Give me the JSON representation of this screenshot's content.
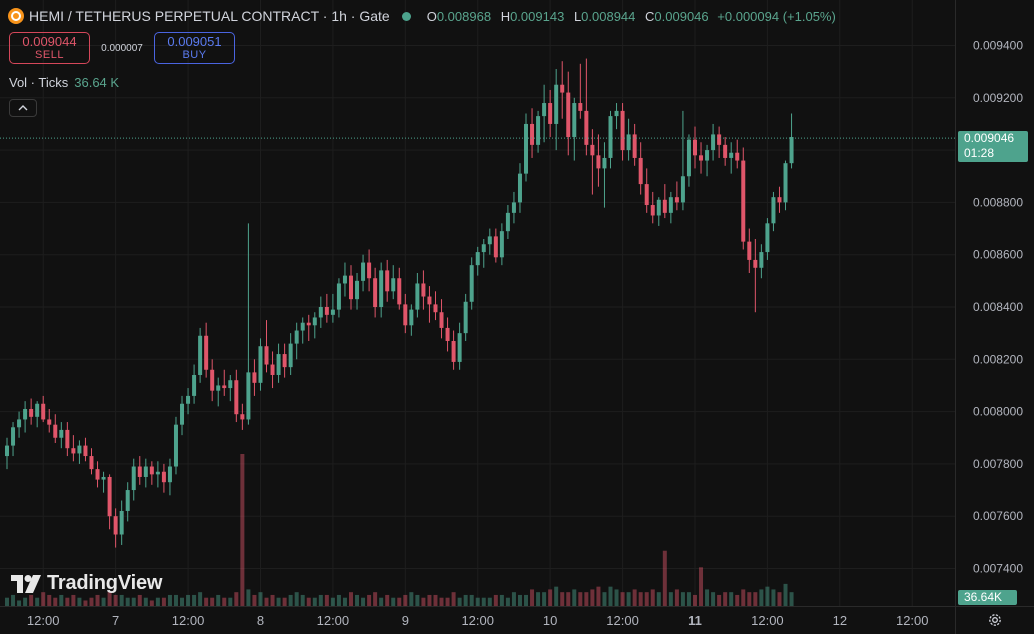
{
  "header": {
    "title": "HEMI / TETHERUS PERPETUAL CONTRACT · 1h · Gate",
    "ohlc": [
      {
        "k": "O",
        "v": "0.008968"
      },
      {
        "k": "H",
        "v": "0.009143"
      },
      {
        "k": "L",
        "v": "0.008944"
      },
      {
        "k": "C",
        "v": "0.009046"
      }
    ],
    "change": "+0.000094 (+1.05%)"
  },
  "trade": {
    "sell_price": "0.009044",
    "sell_label": "SELL",
    "spread": "0.000007",
    "buy_price": "0.009051",
    "buy_label": "BUY"
  },
  "volume_legend": {
    "label": "Vol · Ticks",
    "value": "36.64 K"
  },
  "logo": {
    "text": "TradingView"
  },
  "last_price": {
    "value": "0.009046",
    "countdown": "01:28"
  },
  "volume_tag": "36.64K",
  "colors": {
    "up": "#4ea38d",
    "down": "#e0566a",
    "background": "#111111",
    "grid": "#1e1e1e",
    "text": "#d1d4dc"
  },
  "icons": {
    "symbol": "hemi-logo-icon",
    "status": "market-open-dot-icon",
    "collapse": "chevron-up-icon",
    "settings": "gear-icon"
  },
  "chart_data": {
    "type": "candlestick",
    "y_ticks": [
      "0.009400",
      "0.009200",
      "0.009000",
      "0.008800",
      "0.008600",
      "0.008400",
      "0.008200",
      "0.008000",
      "0.007800",
      "0.007600",
      "0.007400"
    ],
    "ylim": [
      0.0073,
      0.0095
    ],
    "x_ticks": [
      "12:00",
      "7",
      "12:00",
      "8",
      "12:00",
      "9",
      "12:00",
      "10",
      "12:00",
      "11",
      "12:00",
      "12",
      "12:00"
    ],
    "x_tick_candle_index": [
      6,
      18,
      30,
      42,
      54,
      66,
      78,
      90,
      102,
      114,
      126,
      138,
      150
    ],
    "candles": [
      [
        0.00783,
        0.0079,
        0.00778,
        0.00787
      ],
      [
        0.00787,
        0.00796,
        0.00783,
        0.00794
      ],
      [
        0.00794,
        0.008,
        0.0079,
        0.00797
      ],
      [
        0.00797,
        0.00804,
        0.00792,
        0.00801
      ],
      [
        0.00801,
        0.00805,
        0.00795,
        0.00798
      ],
      [
        0.00798,
        0.00804,
        0.00794,
        0.00803
      ],
      [
        0.00803,
        0.00806,
        0.00796,
        0.00797
      ],
      [
        0.00797,
        0.00801,
        0.00792,
        0.00795
      ],
      [
        0.00795,
        0.00799,
        0.00788,
        0.0079
      ],
      [
        0.0079,
        0.00796,
        0.00786,
        0.00793
      ],
      [
        0.00793,
        0.00796,
        0.00783,
        0.00786
      ],
      [
        0.00786,
        0.00791,
        0.00781,
        0.00784
      ],
      [
        0.00784,
        0.00789,
        0.0078,
        0.00787
      ],
      [
        0.00787,
        0.0079,
        0.00781,
        0.00783
      ],
      [
        0.00783,
        0.00786,
        0.00776,
        0.00778
      ],
      [
        0.00778,
        0.00781,
        0.00771,
        0.00774
      ],
      [
        0.00774,
        0.00777,
        0.00769,
        0.00775
      ],
      [
        0.00775,
        0.00776,
        0.00755,
        0.0076
      ],
      [
        0.0076,
        0.00763,
        0.00748,
        0.00753
      ],
      [
        0.00753,
        0.00766,
        0.00749,
        0.00762
      ],
      [
        0.00762,
        0.00773,
        0.00758,
        0.0077
      ],
      [
        0.0077,
        0.00782,
        0.00766,
        0.00779
      ],
      [
        0.00779,
        0.00783,
        0.00772,
        0.00775
      ],
      [
        0.00775,
        0.00782,
        0.00771,
        0.00779
      ],
      [
        0.00779,
        0.00781,
        0.00772,
        0.00776
      ],
      [
        0.00776,
        0.00781,
        0.00771,
        0.00777
      ],
      [
        0.00777,
        0.0078,
        0.00769,
        0.00773
      ],
      [
        0.00773,
        0.00782,
        0.00768,
        0.00779
      ],
      [
        0.00779,
        0.00798,
        0.00776,
        0.00795
      ],
      [
        0.00795,
        0.00806,
        0.00791,
        0.00803
      ],
      [
        0.00803,
        0.00809,
        0.00799,
        0.00806
      ],
      [
        0.00806,
        0.00818,
        0.00803,
        0.00814
      ],
      [
        0.00814,
        0.00832,
        0.00811,
        0.00829
      ],
      [
        0.00829,
        0.00834,
        0.00813,
        0.00816
      ],
      [
        0.00816,
        0.0082,
        0.00804,
        0.00808
      ],
      [
        0.00808,
        0.00813,
        0.00802,
        0.0081
      ],
      [
        0.0081,
        0.00816,
        0.00806,
        0.00809
      ],
      [
        0.00809,
        0.00814,
        0.00804,
        0.00812
      ],
      [
        0.00812,
        0.00816,
        0.00796,
        0.00799
      ],
      [
        0.00799,
        0.00803,
        0.00793,
        0.00797
      ],
      [
        0.00797,
        0.00872,
        0.00795,
        0.00815
      ],
      [
        0.00815,
        0.0082,
        0.00806,
        0.00811
      ],
      [
        0.00811,
        0.00828,
        0.00808,
        0.00825
      ],
      [
        0.00825,
        0.00835,
        0.00815,
        0.00818
      ],
      [
        0.00818,
        0.00823,
        0.00809,
        0.00814
      ],
      [
        0.00814,
        0.00826,
        0.00811,
        0.00822
      ],
      [
        0.00822,
        0.00826,
        0.00813,
        0.00817
      ],
      [
        0.00817,
        0.0083,
        0.00814,
        0.00826
      ],
      [
        0.00826,
        0.00834,
        0.0082,
        0.00831
      ],
      [
        0.00831,
        0.00836,
        0.00826,
        0.00834
      ],
      [
        0.00834,
        0.00837,
        0.00827,
        0.00833
      ],
      [
        0.00833,
        0.00838,
        0.00828,
        0.00836
      ],
      [
        0.00836,
        0.00844,
        0.00832,
        0.0084
      ],
      [
        0.0084,
        0.00845,
        0.00834,
        0.00837
      ],
      [
        0.00837,
        0.00845,
        0.00834,
        0.00839
      ],
      [
        0.00839,
        0.00851,
        0.00836,
        0.00849
      ],
      [
        0.00849,
        0.00857,
        0.00844,
        0.00852
      ],
      [
        0.00852,
        0.00856,
        0.00839,
        0.00843
      ],
      [
        0.00843,
        0.00853,
        0.00839,
        0.0085
      ],
      [
        0.0085,
        0.0086,
        0.00846,
        0.00857
      ],
      [
        0.00857,
        0.00862,
        0.00846,
        0.00851
      ],
      [
        0.00851,
        0.00855,
        0.00836,
        0.0084
      ],
      [
        0.0084,
        0.00857,
        0.00836,
        0.00854
      ],
      [
        0.00854,
        0.00858,
        0.00842,
        0.00846
      ],
      [
        0.00846,
        0.00856,
        0.00843,
        0.00851
      ],
      [
        0.00851,
        0.00855,
        0.00839,
        0.00841
      ],
      [
        0.00841,
        0.00845,
        0.0083,
        0.00833
      ],
      [
        0.00833,
        0.00841,
        0.00829,
        0.00839
      ],
      [
        0.00839,
        0.00853,
        0.00836,
        0.00849
      ],
      [
        0.00849,
        0.00854,
        0.00839,
        0.00844
      ],
      [
        0.00844,
        0.00848,
        0.00834,
        0.00841
      ],
      [
        0.00841,
        0.00846,
        0.00835,
        0.00838
      ],
      [
        0.00838,
        0.00843,
        0.00828,
        0.00832
      ],
      [
        0.00832,
        0.00836,
        0.00823,
        0.00827
      ],
      [
        0.00827,
        0.00831,
        0.00816,
        0.00819
      ],
      [
        0.00819,
        0.00834,
        0.00816,
        0.0083
      ],
      [
        0.0083,
        0.00845,
        0.00827,
        0.00842
      ],
      [
        0.00842,
        0.00859,
        0.00839,
        0.00856
      ],
      [
        0.00856,
        0.00863,
        0.00852,
        0.00861
      ],
      [
        0.00861,
        0.00866,
        0.00855,
        0.00864
      ],
      [
        0.00864,
        0.0087,
        0.0086,
        0.00867
      ],
      [
        0.00867,
        0.0087,
        0.00857,
        0.00859
      ],
      [
        0.00859,
        0.00872,
        0.00856,
        0.00869
      ],
      [
        0.00869,
        0.00879,
        0.00866,
        0.00876
      ],
      [
        0.00876,
        0.00884,
        0.00872,
        0.0088
      ],
      [
        0.0088,
        0.00895,
        0.00876,
        0.00891
      ],
      [
        0.00891,
        0.00914,
        0.00888,
        0.0091
      ],
      [
        0.0091,
        0.00916,
        0.00897,
        0.00902
      ],
      [
        0.00902,
        0.00915,
        0.00899,
        0.00913
      ],
      [
        0.00913,
        0.00925,
        0.00903,
        0.00918
      ],
      [
        0.00918,
        0.00923,
        0.00905,
        0.0091
      ],
      [
        0.0091,
        0.00931,
        0.009,
        0.00925
      ],
      [
        0.00925,
        0.00934,
        0.00912,
        0.00922
      ],
      [
        0.00922,
        0.0093,
        0.00898,
        0.00905
      ],
      [
        0.00905,
        0.0092,
        0.00896,
        0.00918
      ],
      [
        0.00918,
        0.00933,
        0.00912,
        0.00915
      ],
      [
        0.00915,
        0.00935,
        0.00898,
        0.00902
      ],
      [
        0.00902,
        0.00908,
        0.00883,
        0.00898
      ],
      [
        0.00898,
        0.00906,
        0.00886,
        0.00893
      ],
      [
        0.00893,
        0.00903,
        0.00878,
        0.00897
      ],
      [
        0.00897,
        0.00915,
        0.00893,
        0.00913
      ],
      [
        0.00913,
        0.00918,
        0.00908,
        0.00915
      ],
      [
        0.00915,
        0.00918,
        0.00896,
        0.009
      ],
      [
        0.009,
        0.00912,
        0.00896,
        0.00906
      ],
      [
        0.00906,
        0.0091,
        0.00894,
        0.00897
      ],
      [
        0.00897,
        0.00903,
        0.00883,
        0.00887
      ],
      [
        0.00887,
        0.00893,
        0.00876,
        0.00879
      ],
      [
        0.00879,
        0.00884,
        0.00872,
        0.00875
      ],
      [
        0.00875,
        0.00882,
        0.00871,
        0.00881
      ],
      [
        0.00881,
        0.00887,
        0.00874,
        0.00876
      ],
      [
        0.00876,
        0.00884,
        0.00872,
        0.00882
      ],
      [
        0.00882,
        0.00888,
        0.00877,
        0.0088
      ],
      [
        0.0088,
        0.00915,
        0.00877,
        0.0089
      ],
      [
        0.0089,
        0.00906,
        0.00886,
        0.00904
      ],
      [
        0.00904,
        0.00909,
        0.00893,
        0.00898
      ],
      [
        0.00898,
        0.00903,
        0.00891,
        0.00896
      ],
      [
        0.00896,
        0.00902,
        0.0089,
        0.009
      ],
      [
        0.009,
        0.0091,
        0.00896,
        0.00906
      ],
      [
        0.00906,
        0.00909,
        0.00897,
        0.00902
      ],
      [
        0.00902,
        0.00905,
        0.00894,
        0.00897
      ],
      [
        0.00897,
        0.00903,
        0.00891,
        0.00899
      ],
      [
        0.00899,
        0.00904,
        0.00893,
        0.00896
      ],
      [
        0.00896,
        0.00901,
        0.00862,
        0.00865
      ],
      [
        0.00865,
        0.0087,
        0.00853,
        0.00858
      ],
      [
        0.00858,
        0.00866,
        0.00838,
        0.00855
      ],
      [
        0.00855,
        0.00864,
        0.00851,
        0.00861
      ],
      [
        0.00861,
        0.00874,
        0.00858,
        0.00872
      ],
      [
        0.00872,
        0.00884,
        0.00869,
        0.00882
      ],
      [
        0.00882,
        0.00886,
        0.00876,
        0.0088
      ],
      [
        0.0088,
        0.00896,
        0.00877,
        0.00895
      ],
      [
        0.00895,
        0.00914,
        0.00893,
        0.00905
      ]
    ],
    "volume": [
      3,
      4,
      2,
      3,
      4,
      3,
      5,
      4,
      3,
      4,
      3,
      4,
      3,
      2,
      3,
      4,
      3,
      5,
      4,
      4,
      3,
      3,
      4,
      3,
      2,
      3,
      3,
      4,
      4,
      3,
      4,
      4,
      5,
      3,
      3,
      4,
      3,
      3,
      5,
      55,
      6,
      4,
      5,
      3,
      4,
      3,
      3,
      4,
      5,
      4,
      3,
      3,
      4,
      4,
      3,
      4,
      3,
      5,
      4,
      3,
      4,
      5,
      3,
      4,
      3,
      3,
      4,
      5,
      4,
      3,
      4,
      4,
      3,
      3,
      5,
      3,
      4,
      4,
      3,
      3,
      3,
      4,
      4,
      3,
      5,
      4,
      4,
      6,
      5,
      5,
      6,
      7,
      5,
      5,
      6,
      5,
      5,
      6,
      7,
      5,
      7,
      6,
      5,
      5,
      6,
      5,
      5,
      6,
      5,
      20,
      5,
      6,
      5,
      5,
      4,
      14,
      6,
      5,
      4,
      5,
      5,
      4,
      6,
      5,
      5,
      6,
      7,
      6,
      5,
      8,
      5,
      4,
      5,
      5,
      5,
      5,
      6,
      7,
      6,
      7,
      7
    ]
  }
}
